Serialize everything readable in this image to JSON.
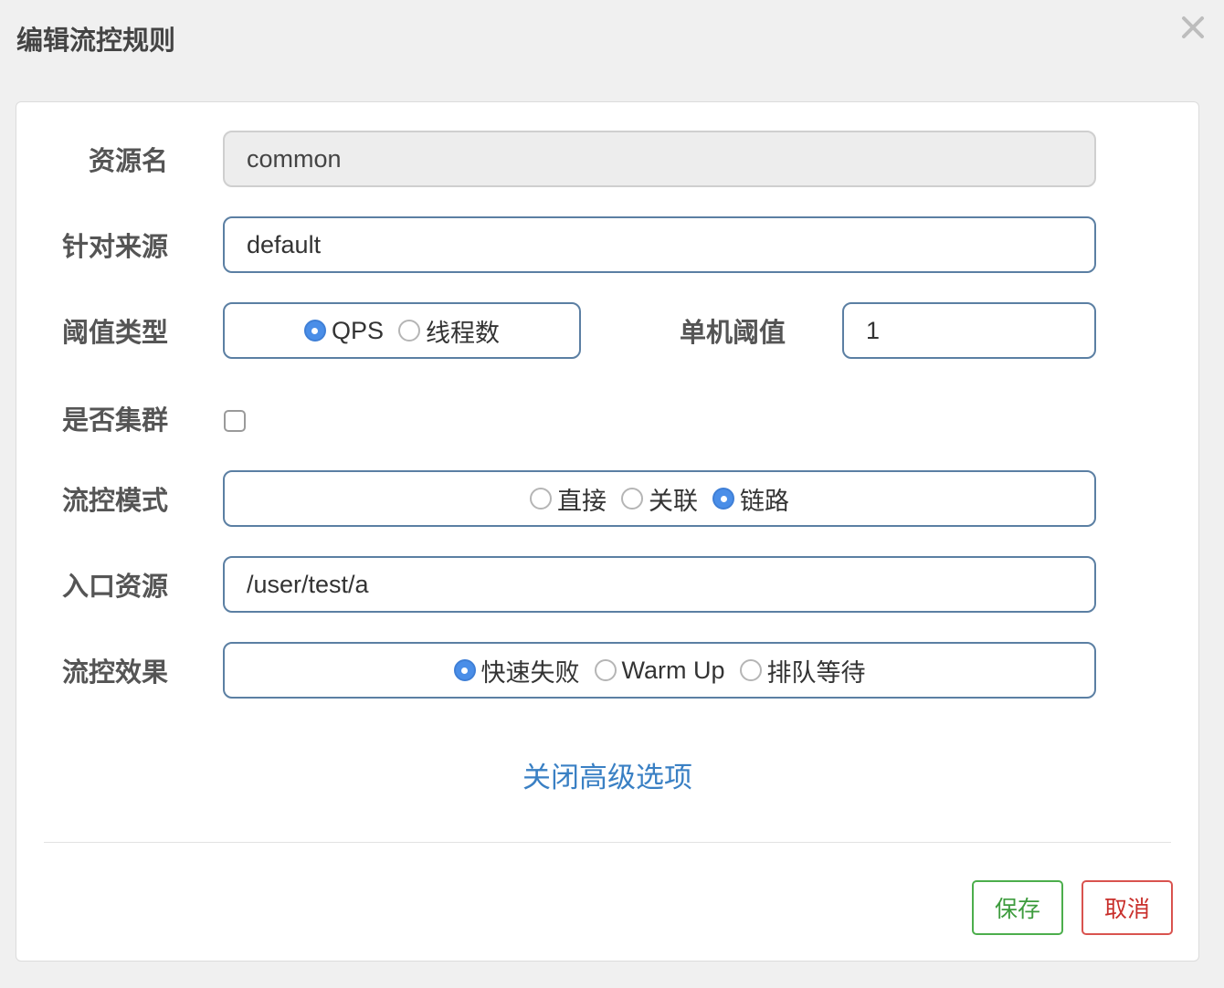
{
  "dialog": {
    "title": "编辑流控规则"
  },
  "icons": {
    "close": "close-icon"
  },
  "form": {
    "resource": {
      "label": "资源名",
      "value": "common"
    },
    "origin": {
      "label": "针对来源",
      "value": "default"
    },
    "threshold_type": {
      "label": "阈值类型",
      "options": [
        {
          "label": "QPS",
          "checked": true
        },
        {
          "label": "线程数",
          "checked": false
        }
      ]
    },
    "single_threshold": {
      "label": "单机阈值",
      "value": "1"
    },
    "cluster": {
      "label": "是否集群",
      "checked": false
    },
    "flow_mode": {
      "label": "流控模式",
      "options": [
        {
          "label": "直接",
          "checked": false
        },
        {
          "label": "关联",
          "checked": false
        },
        {
          "label": "链路",
          "checked": true
        }
      ]
    },
    "entry_resource": {
      "label": "入口资源",
      "value": "/user/test/a"
    },
    "flow_effect": {
      "label": "流控效果",
      "options": [
        {
          "label": "快速失败",
          "checked": true
        },
        {
          "label": "Warm Up",
          "checked": false
        },
        {
          "label": "排队等待",
          "checked": false
        }
      ]
    },
    "advanced_toggle": "关闭高级选项"
  },
  "buttons": {
    "save": "保存",
    "cancel": "取消"
  },
  "colors": {
    "accent_blue": "#4a8ee8",
    "link_blue": "#3a80c4",
    "save_green": "#4cae4c",
    "cancel_red": "#d9534f",
    "input_border": "#5b7fa3"
  }
}
